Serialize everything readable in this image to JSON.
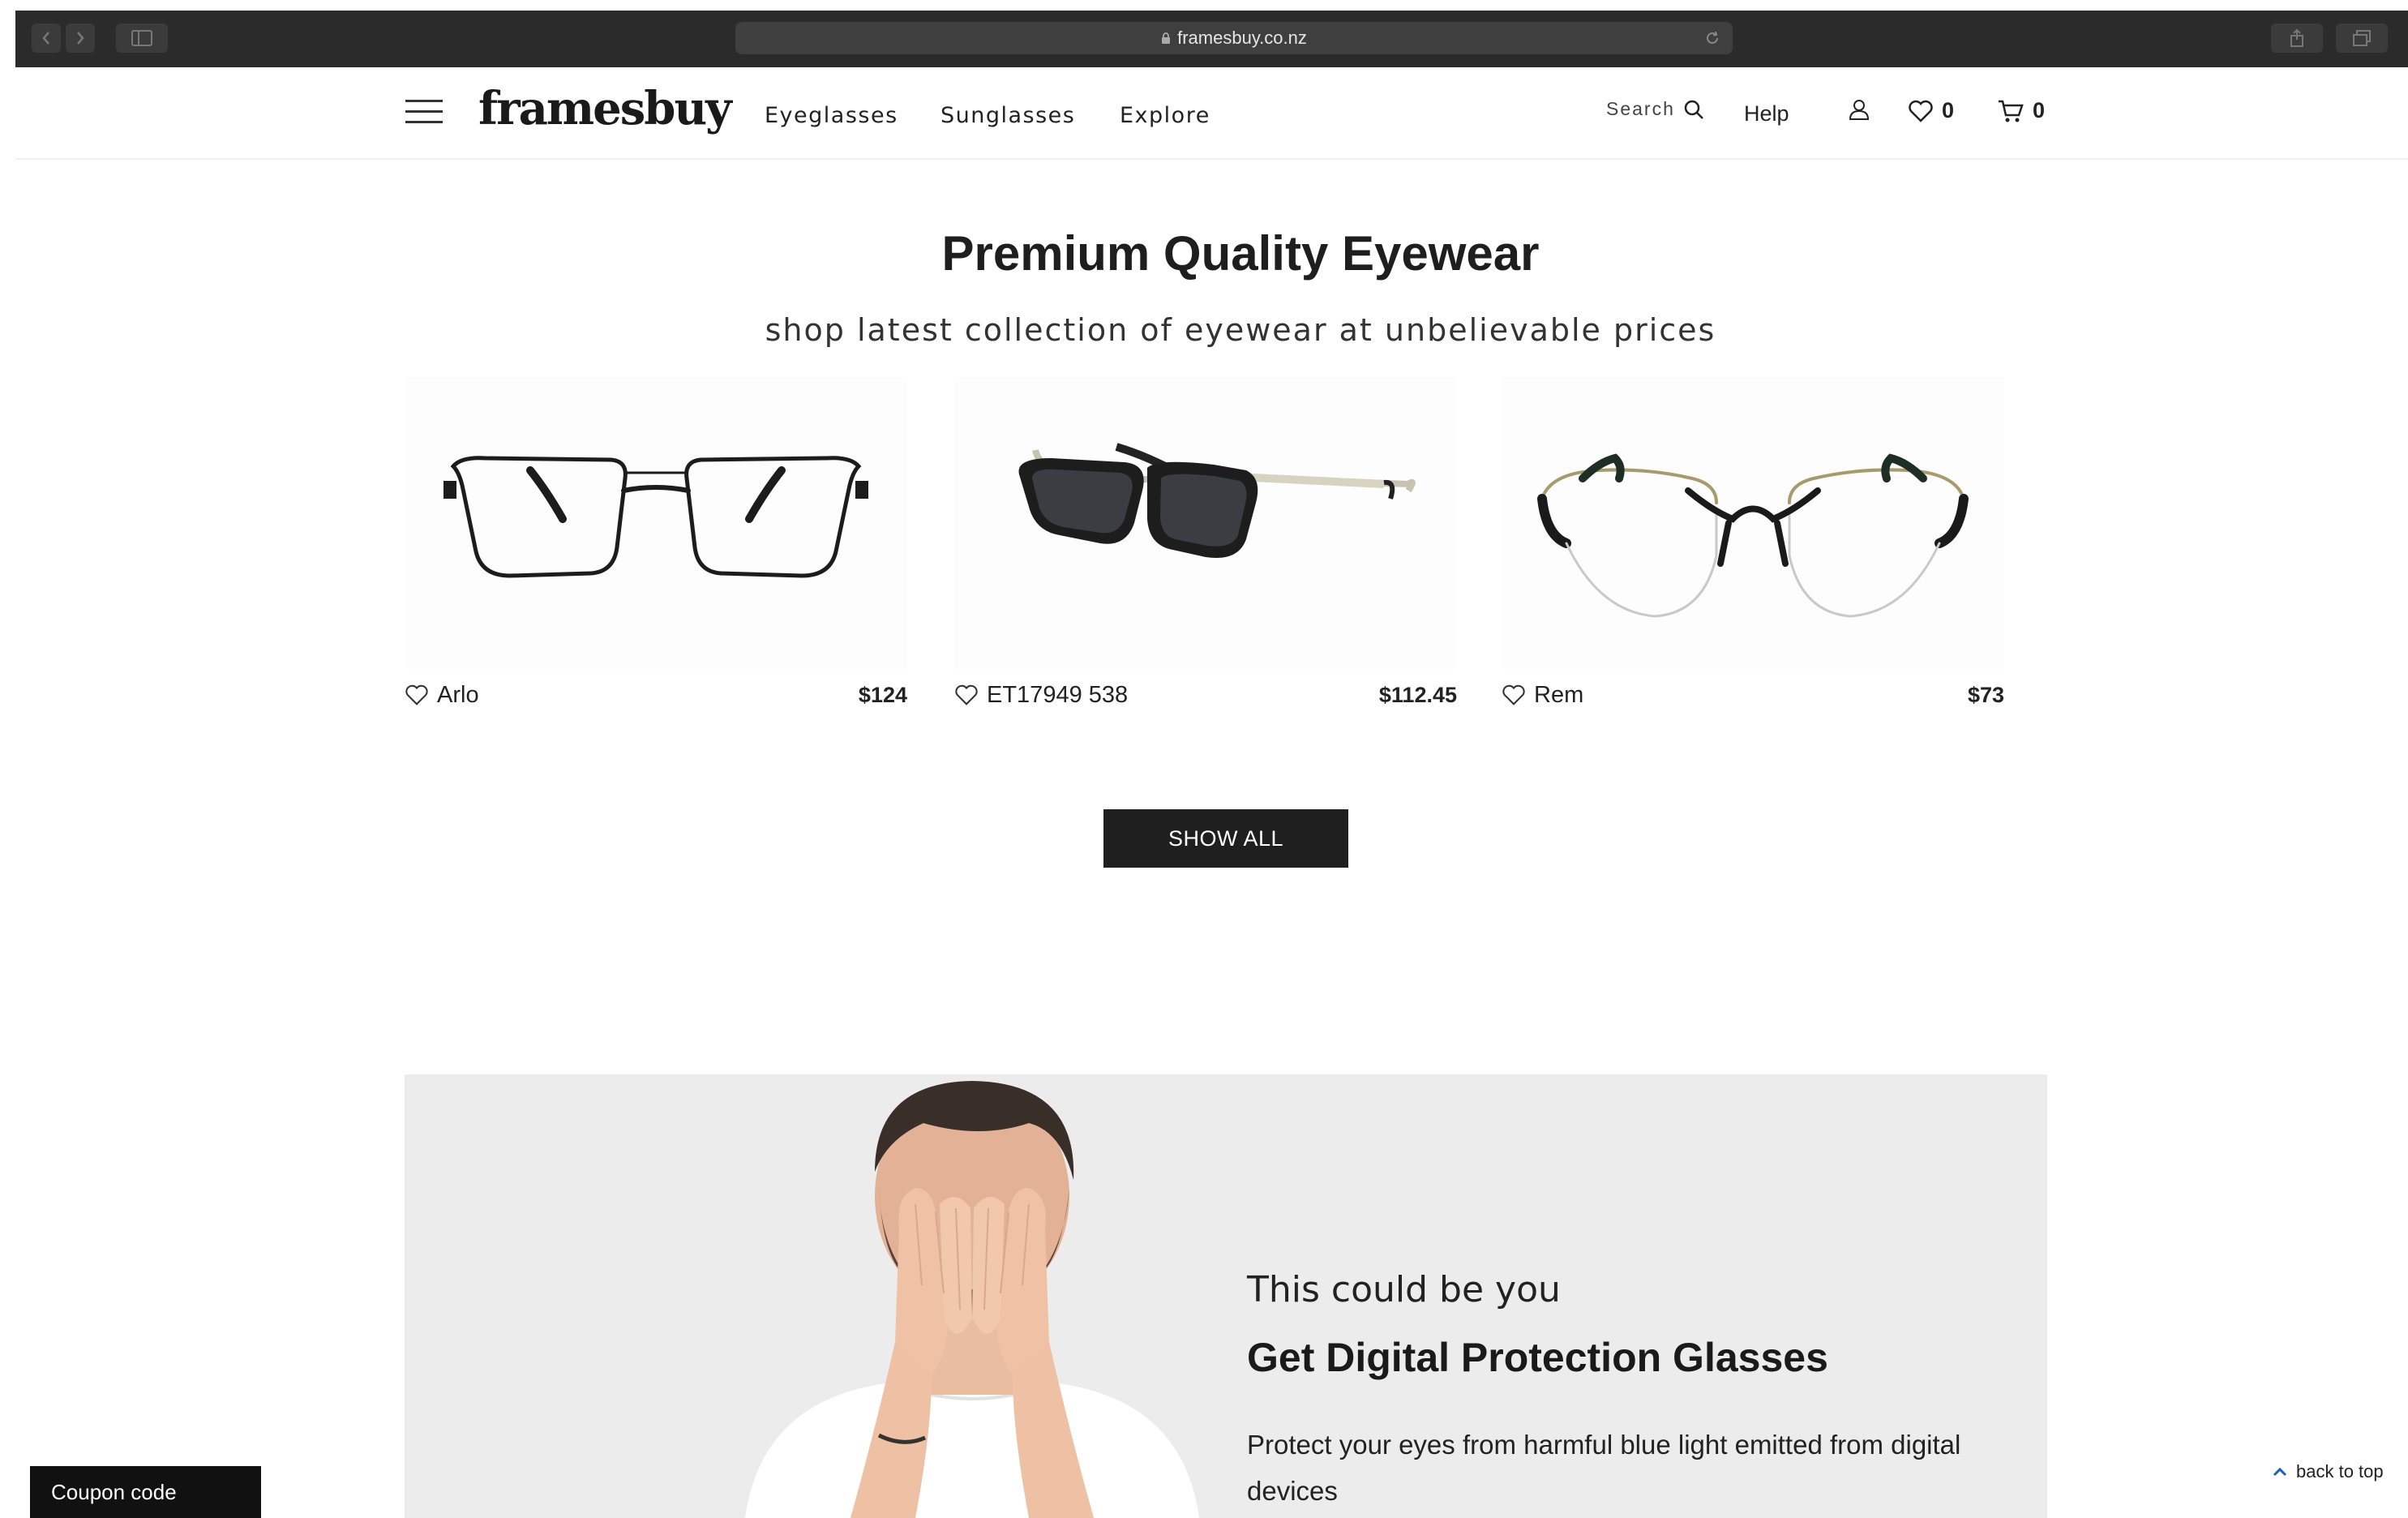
{
  "browser": {
    "url": "framesbuy.co.nz"
  },
  "header": {
    "logo": "framesbuy",
    "nav": [
      "Eyeglasses",
      "Sunglasses",
      "Explore"
    ],
    "search_label": "Search",
    "help_label": "Help",
    "wishlist_count": "0",
    "cart_count": "0"
  },
  "hero": {
    "title": "Premium Quality Eyewear",
    "subtitle": "shop latest collection of eyewear at unbelievable prices"
  },
  "products": [
    {
      "name": "Arlo",
      "price": "$124",
      "style": "black-metal-rectangular"
    },
    {
      "name": "ET17949 538",
      "price": "$112.45",
      "style": "dark-sunglasses-gold-temples"
    },
    {
      "name": "Rem",
      "price": "$73",
      "style": "semi-rimless-cat-eye"
    }
  ],
  "show_all_label": "SHOW ALL",
  "banner": {
    "line1": "This could be you",
    "headline": "Get Digital Protection Glasses",
    "body": "Protect your eyes from harmful blue light emitted from digital devices"
  },
  "coupon_label": "Coupon code",
  "back_to_top_label": "back to top",
  "colors": {
    "chrome": "#2b2b2b",
    "button_dark": "#1f1f1f",
    "banner_bg": "#ececec"
  }
}
